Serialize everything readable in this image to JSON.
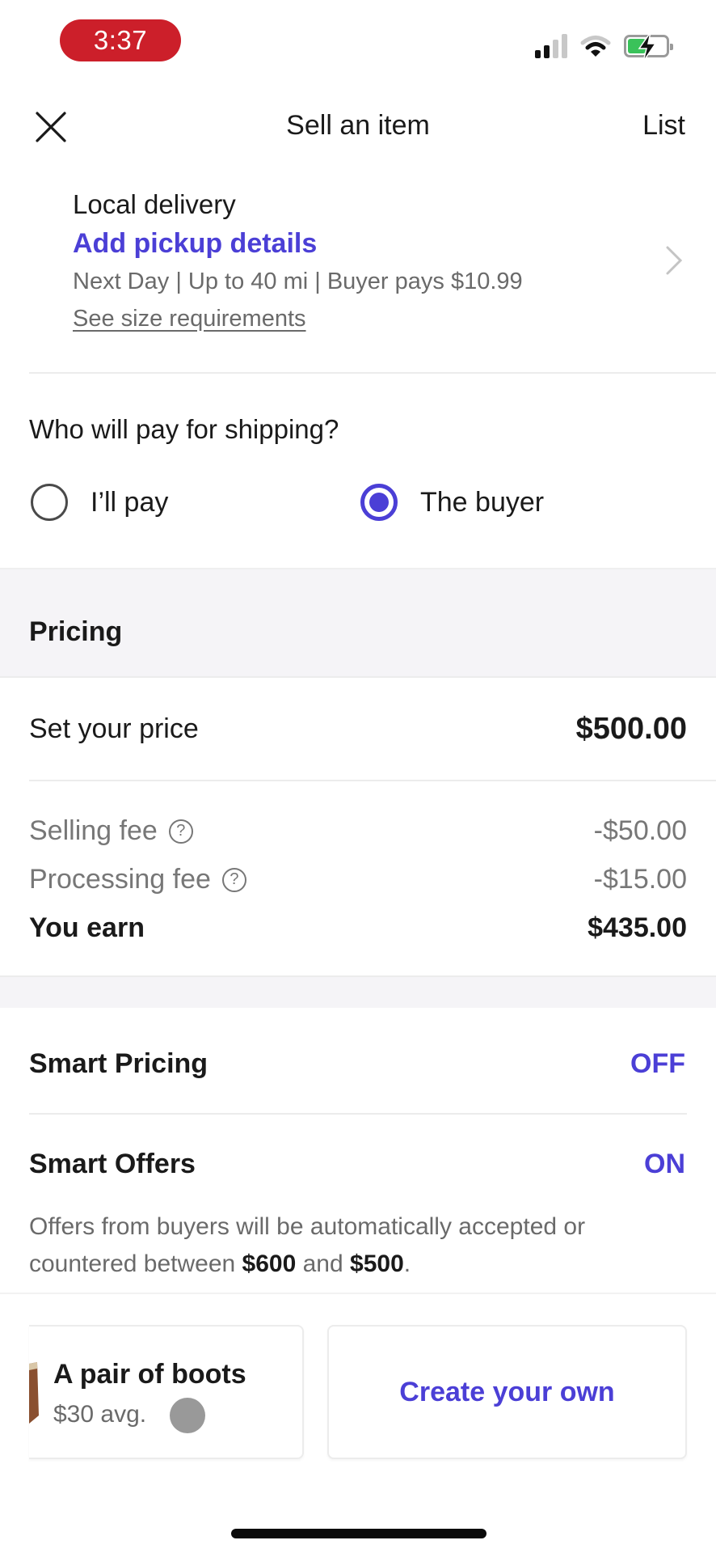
{
  "status_bar": {
    "time": "3:37",
    "icons": [
      "cellular-signal-icon",
      "wifi-icon",
      "battery-charging-icon"
    ]
  },
  "nav": {
    "close_icon": "close-icon",
    "title": "Sell an item",
    "list_label": "List"
  },
  "local_delivery": {
    "label": "Local delivery",
    "action": "Add pickup details",
    "meta": "Next Day | Up to 40 mi | Buyer pays $10.99",
    "size_link": "See size requirements",
    "chevron_icon": "chevron-right-icon"
  },
  "shipping": {
    "question": "Who will pay for shipping?",
    "options": [
      {
        "label": "I’ll pay",
        "selected": false
      },
      {
        "label": "The buyer",
        "selected": true
      }
    ]
  },
  "pricing": {
    "header": "Pricing",
    "set_price_label": "Set your price",
    "set_price_value": "$500.00",
    "fees": [
      {
        "label": "Selling fee",
        "value": "-$50.00",
        "help_icon": "question-circle-icon"
      },
      {
        "label": "Processing fee",
        "value": "-$15.00",
        "help_icon": "question-circle-icon"
      }
    ],
    "earn_label": "You earn",
    "earn_value": "$435.00"
  },
  "smart_pricing": {
    "label": "Smart Pricing",
    "state": "OFF"
  },
  "smart_offers": {
    "label": "Smart Offers",
    "state": "ON",
    "desc_prefix": "Offers from buyers will be automatically accepted or countered between ",
    "high": "$600",
    "desc_mid": " and ",
    "low": "$500",
    "desc_suffix": "."
  },
  "cards": {
    "suggestion": {
      "name": "A pair of boots",
      "avg": "$30 avg."
    },
    "create_label": "Create your own"
  },
  "colors": {
    "accent": "#4b3fd6",
    "time_pill": "#cc1f2a",
    "section_bg": "#f5f4f7"
  }
}
